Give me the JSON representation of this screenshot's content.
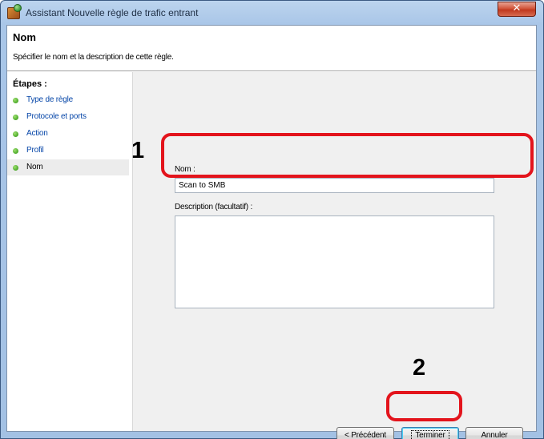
{
  "window": {
    "title": "Assistant Nouvelle règle de trafic entrant",
    "close_label": "✕"
  },
  "header": {
    "title": "Nom",
    "subtitle": "Spécifier le nom et la description de cette règle."
  },
  "sidebar": {
    "title": "Étapes :",
    "items": [
      {
        "label": "Type de règle"
      },
      {
        "label": "Protocole et ports"
      },
      {
        "label": "Action"
      },
      {
        "label": "Profil"
      },
      {
        "label": "Nom"
      }
    ],
    "active_index": 4
  },
  "form": {
    "name_label": "Nom :",
    "name_value": "Scan to SMB",
    "description_label": "Description (facultatif) :",
    "description_value": ""
  },
  "buttons": {
    "back": "< Précédent",
    "finish": "Terminer",
    "cancel": "Annuler"
  },
  "callouts": {
    "one": "1",
    "two": "2",
    "color": "#e3141c"
  },
  "colors": {
    "title_bar": "#a9c6e8",
    "link": "#0646a8",
    "step_dot": "#3ea01e"
  }
}
